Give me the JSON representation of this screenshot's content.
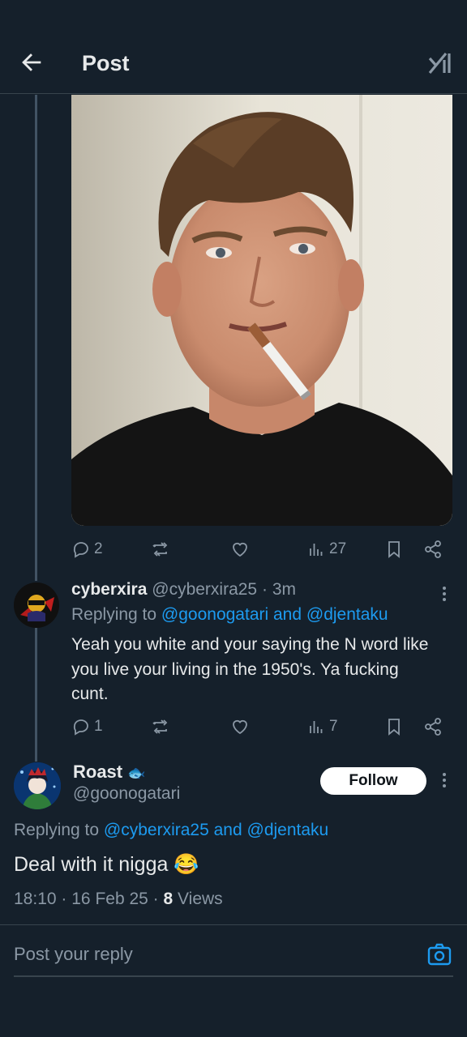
{
  "header": {
    "title": "Post"
  },
  "parent_post": {
    "stats": {
      "replies": "2",
      "views": "27"
    }
  },
  "reply1": {
    "name": "cyberxira",
    "handle": "@cyberxira25",
    "sep": "·",
    "time": "3m",
    "replying_prefix": "Replying to",
    "replying_user1": "@goonogatari",
    "replying_and": "and",
    "replying_user2": "@djentaku",
    "text": "Yeah you white and your saying the N word like you live your living in the 1950's. Ya fucking cunt.",
    "stats": {
      "replies": "1",
      "views": "7"
    }
  },
  "main_post": {
    "name": "Roast",
    "name_emoji": "🐟",
    "handle": "@goonogatari",
    "follow_label": "Follow",
    "replying_prefix": "Replying to",
    "replying_user1": "@cyberxira25",
    "replying_and": "and",
    "replying_user2": "@djentaku",
    "text": "Deal with it nigga 😂",
    "time": "18:10",
    "sep1": "·",
    "date": "16 Feb 25",
    "sep2": "·",
    "views_count": "8",
    "views_label": "Views"
  },
  "reply_box": {
    "placeholder": "Post your reply"
  },
  "colors": {
    "bg": "#15202b",
    "accent": "#1d9bf0",
    "muted": "#8b98a5",
    "divider": "#38444d"
  }
}
